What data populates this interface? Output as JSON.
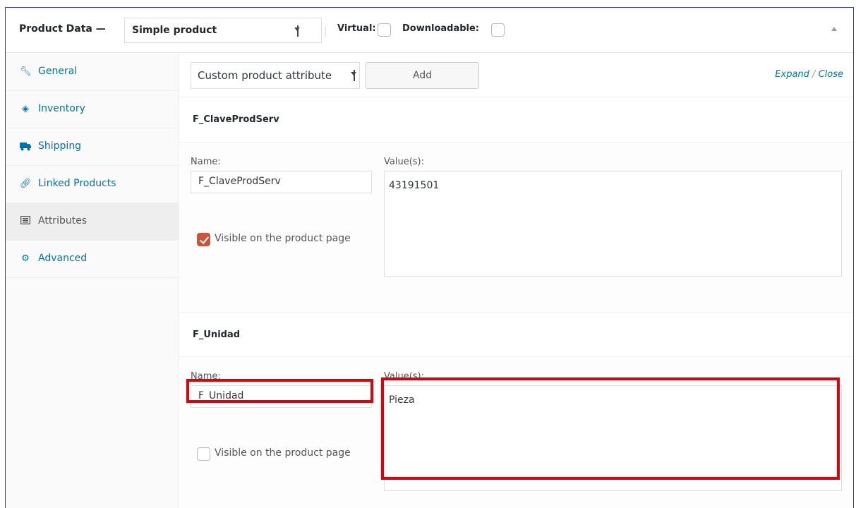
{
  "header": {
    "title": "Product Data —",
    "product_type": "Simple product",
    "virtual_label": "Virtual:",
    "virtual_checked": false,
    "downloadable_label": "Downloadable:",
    "downloadable_checked": false
  },
  "sidebar": {
    "items": [
      {
        "label": "General",
        "icon": "wrench-icon"
      },
      {
        "label": "Inventory",
        "icon": "tag-icon"
      },
      {
        "label": "Shipping",
        "icon": "truck-icon"
      },
      {
        "label": "Linked Products",
        "icon": "link-icon"
      },
      {
        "label": "Attributes",
        "icon": "list-icon",
        "active": true
      },
      {
        "label": "Advanced",
        "icon": "gear-icon"
      }
    ]
  },
  "toolbar": {
    "attribute_select": "Custom product attribute",
    "add_label": "Add",
    "expand_label": "Expand",
    "slash": "/",
    "close_label": "Close"
  },
  "attributes": [
    {
      "title": "F_ClaveProdServ",
      "name_label": "Name:",
      "name_value": "F_ClaveProdServ",
      "values_label": "Value(s):",
      "values_value": "43191501",
      "visible_label": "Visible on the product page",
      "visible_checked": true
    },
    {
      "title": "F_Unidad",
      "name_label": "Name:",
      "name_value": "F_Unidad",
      "values_label": "Value(s):",
      "values_value": "Pieza",
      "visible_label": "Visible on the product page",
      "visible_checked": false
    }
  ],
  "colors": {
    "link": "#0073aa",
    "highlight": "#e0000a",
    "checkbox_checked": "#c9553b"
  }
}
